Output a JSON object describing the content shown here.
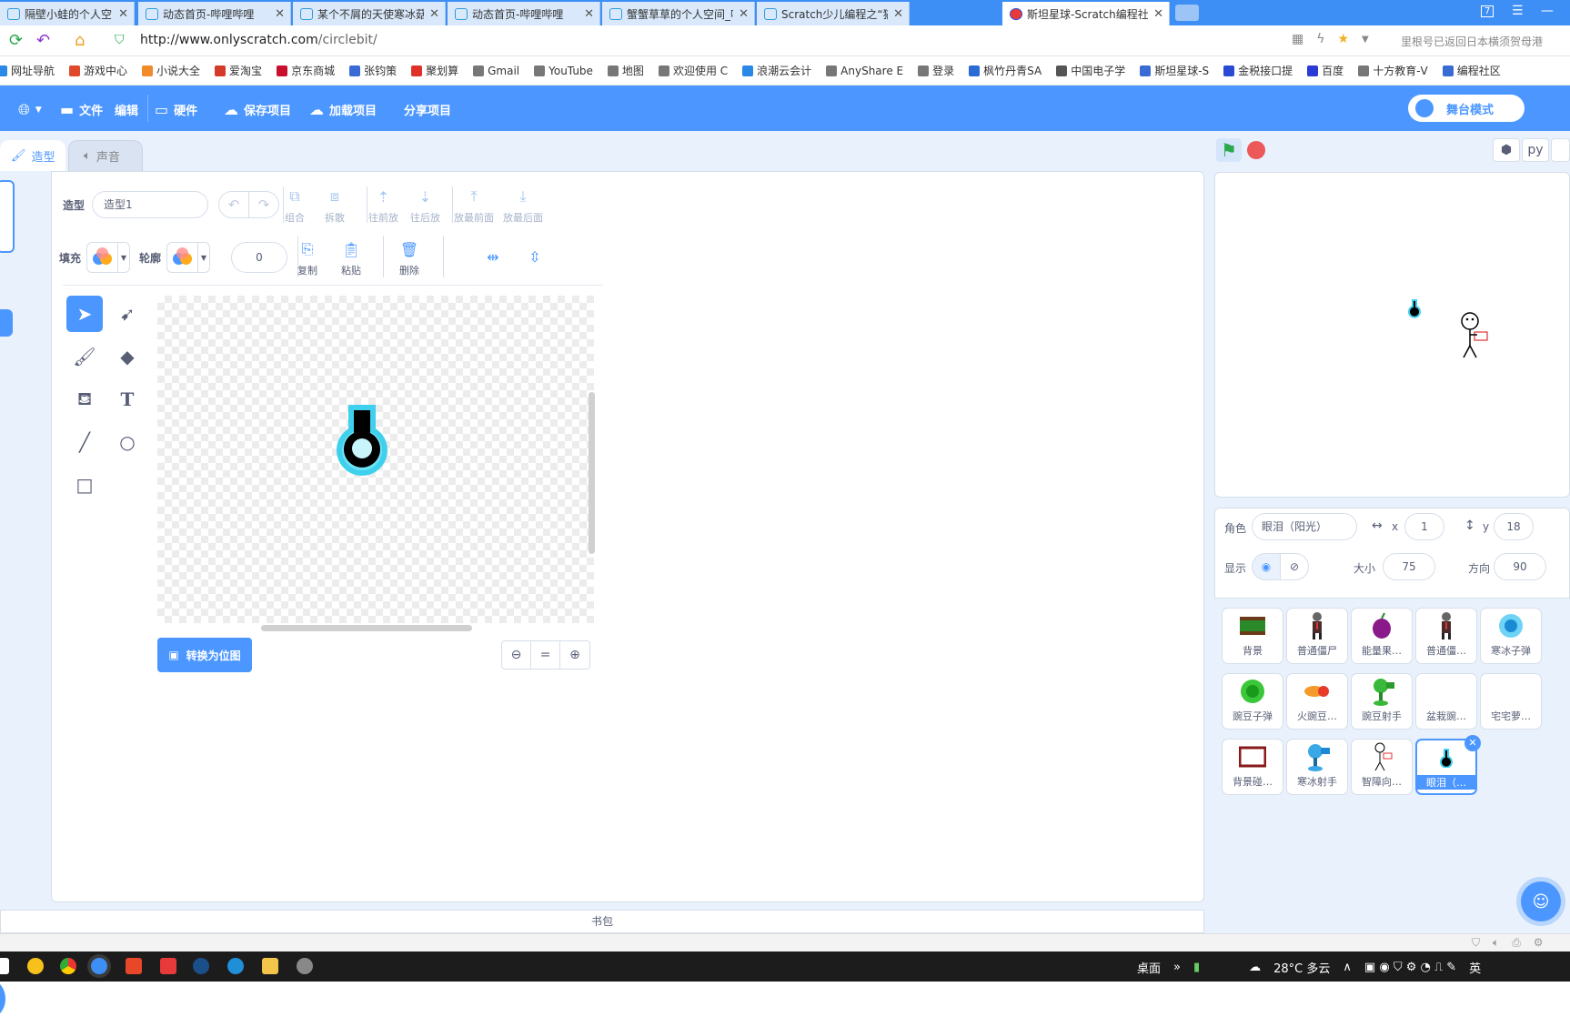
{
  "browser": {
    "tabs": [
      {
        "label": "隔壁小蛙的个人空间_哔"
      },
      {
        "label": "动态首页-哔哩哔哩"
      },
      {
        "label": "某个不屑的天使寒冰菇的"
      },
      {
        "label": "动态首页-哔哩哔哩"
      },
      {
        "label": "蟹蟹草草的个人空间_哔"
      },
      {
        "label": "Scratch少儿编程之“猫"
      },
      {
        "label": "斯坦星球-Scratch编程社"
      }
    ],
    "tab_count_badge": "7",
    "url_host": "http://www.onlyscratch.com",
    "url_path": "/circlebit/",
    "address_hint": "里根号已返回日本横须贺母港",
    "bookmarks": [
      {
        "label": "网址导航",
        "color": "#2a88e6"
      },
      {
        "label": "游戏中心",
        "color": "#e04a2a"
      },
      {
        "label": "小说大全",
        "color": "#f08a2a"
      },
      {
        "label": "爱淘宝",
        "color": "#d43a2a"
      },
      {
        "label": "京东商城",
        "color": "#c8102e"
      },
      {
        "label": "张钧策",
        "color": "#3a6ad4"
      },
      {
        "label": "聚划算",
        "color": "#e0302a"
      },
      {
        "label": "Gmail",
        "color": "#777777"
      },
      {
        "label": "YouTube",
        "color": "#777777"
      },
      {
        "label": "地图",
        "color": "#777777"
      },
      {
        "label": "欢迎使用 C",
        "color": "#777777"
      },
      {
        "label": "浪潮云会计",
        "color": "#2a88e6"
      },
      {
        "label": "AnyShare E",
        "color": "#777777"
      },
      {
        "label": "登录",
        "color": "#777777"
      },
      {
        "label": "枫竹丹青SA",
        "color": "#2a6ad4"
      },
      {
        "label": "中国电子学",
        "color": "#555555"
      },
      {
        "label": "斯坦星球-S",
        "color": "#3a6ad4"
      },
      {
        "label": "金税接口提",
        "color": "#2a4ad4"
      },
      {
        "label": "百度",
        "color": "#2a3ad4"
      },
      {
        "label": "十方教育-V",
        "color": "#777777"
      },
      {
        "label": "编程社区",
        "color": "#3a6ad4"
      }
    ]
  },
  "menubar": {
    "file": "文件",
    "edit": "编辑",
    "hardware": "硬件",
    "save": "保存项目",
    "load": "加载项目",
    "share": "分享项目",
    "stage_mode": "舞台模式",
    "accent": "#4c97ff"
  },
  "editor_tabs": {
    "costume": "造型",
    "sound": "声音"
  },
  "paint": {
    "costume_label": "造型",
    "costume_name": "造型1",
    "group": "组合",
    "ungroup": "拆散",
    "forward": "往前放",
    "backward": "往后放",
    "front": "放最前面",
    "back": "放最后面",
    "fill_label": "填充",
    "outline_label": "轮廓",
    "outline_width": "0",
    "copy": "复制",
    "paste": "粘贴",
    "delete": "删除",
    "convert_bitmap": "转换为位图",
    "zoom_reset": "="
  },
  "backpack": "书包",
  "stage": {
    "python_label": "py"
  },
  "sprite_info": {
    "sprite_label": "角色",
    "sprite_name": "眼泪（阳光）",
    "x_label": "x",
    "x": "1",
    "y_label": "y",
    "y": "18",
    "show_label": "显示",
    "size_label": "大小",
    "size": "75",
    "direction_label": "方向",
    "direction": "90"
  },
  "sprites": [
    {
      "name": "背景",
      "icon": "grass"
    },
    {
      "name": "普通僵尸",
      "icon": "zombie"
    },
    {
      "name": "能量果…",
      "icon": "berry"
    },
    {
      "name": "普通僵…",
      "icon": "zombie"
    },
    {
      "name": "寒冰子弹",
      "icon": "icepea"
    },
    {
      "name": "豌豆子弹",
      "icon": "pea"
    },
    {
      "name": "火豌豆…",
      "icon": "firepea"
    },
    {
      "name": "豌豆射手",
      "icon": "peashooter"
    },
    {
      "name": "盆栽豌…",
      "icon": "blank"
    },
    {
      "name": "宅宅萝…",
      "icon": "blank"
    },
    {
      "name": "背景碰…",
      "icon": "frame"
    },
    {
      "name": "寒冰射手",
      "icon": "snowpea"
    },
    {
      "name": "智障向…",
      "icon": "stick"
    },
    {
      "name": "眼泪（…",
      "icon": "flask",
      "selected": true
    }
  ],
  "taskbar": {
    "desktop": "桌面",
    "weather": "28°C 多云",
    "ime": "英"
  }
}
